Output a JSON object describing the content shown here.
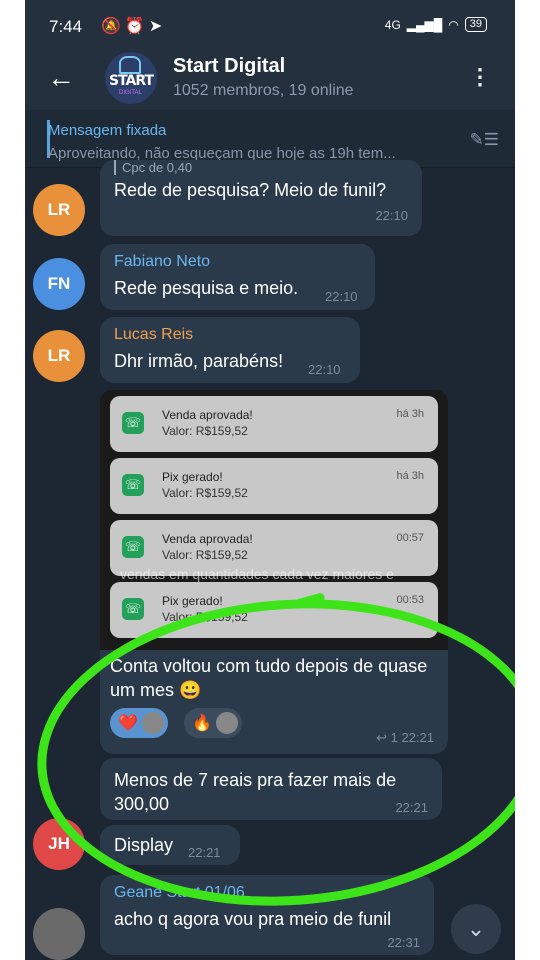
{
  "status": {
    "time": "7:44",
    "battery": "39",
    "icons_left": "🔕⏰➤",
    "network": "4G"
  },
  "header": {
    "title": "Start Digital",
    "subtitle": "1052 membros, 19 online",
    "avatar_text": "START",
    "avatar_sub": "DIGITAL"
  },
  "pinned": {
    "title": "Mensagem fixada",
    "text": "Aproveitando, não esqueçam que hoje as 19h tem..."
  },
  "messages": [
    {
      "avatar": "LR",
      "avatar_color": "#e8913a",
      "quote": "Cpc de 0,40",
      "text": "Rede de pesquisa? Meio de funil?",
      "time": "22:10"
    },
    {
      "avatar": "FN",
      "avatar_color": "#4a8fe0",
      "name": "Fabiano Neto",
      "name_color": "#6ab7f0",
      "text": "Rede pesquisa e meio.",
      "time": "22:10"
    },
    {
      "avatar": "LR",
      "avatar_color": "#e8913a",
      "name": "Lucas Reis",
      "name_color": "#f0a050",
      "text": "Dhr irmão, parabéns!",
      "time": "22:10"
    },
    {
      "text": "Conta voltou com tudo  depois de quase um mes 😀",
      "time": "22:21",
      "replies": "1"
    },
    {
      "text": "Menos de 7 reais pra fazer mais de 300,00",
      "time": "22:21"
    },
    {
      "avatar": "JH",
      "avatar_color": "#e04848",
      "text": "Display",
      "time": "22:21"
    },
    {
      "name": "Geane Start 01/06",
      "name_color": "#6ab7f0",
      "text": "acho q agora vou pra meio de funil",
      "time": "22:31"
    }
  ],
  "notifications": [
    {
      "title": "Venda aprovada!",
      "value": "Valor: R$159,52",
      "when": "há 3h"
    },
    {
      "title": "Pix gerado!",
      "value": "Valor: R$159,52",
      "when": "há 3h"
    },
    {
      "title": "Venda aprovada!",
      "value": "Valor: R$159,52",
      "when": "00:57"
    },
    {
      "title": "Pix gerado!",
      "value": "Valor: R$159,52",
      "when": "00:53"
    }
  ],
  "screenshot_blur_text": "vendas em quantidades cada vez maiores e",
  "reactions": [
    {
      "emoji": "❤️"
    },
    {
      "emoji": "🔥"
    }
  ]
}
